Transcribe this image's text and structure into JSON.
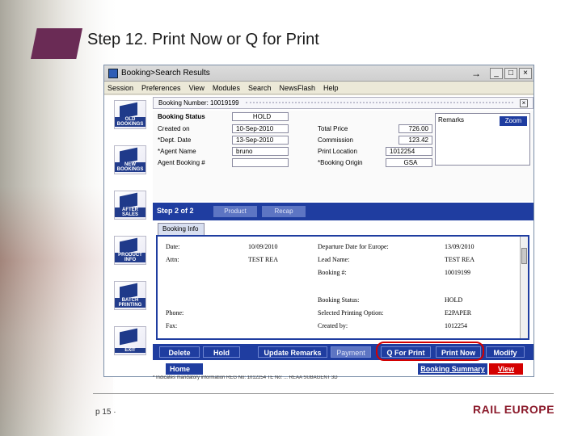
{
  "slide": {
    "title": "Step 12. Print Now or Q for Print",
    "page": "p 15 ·",
    "brand": "RAIL EUROPE",
    "accent": "#6a2b55"
  },
  "window": {
    "title": "Booking>Search Results",
    "menu": [
      "Session",
      "Preferences",
      "View",
      "Modules",
      "Search",
      "NewsFlash",
      "Help"
    ]
  },
  "sidebar": {
    "items": [
      "OLD BOOKINGS",
      "NEW BOOKINGS",
      "AFTER SALES",
      "PRODUCT INFO",
      "BATCH PRINTING",
      "EXIT"
    ]
  },
  "booking": {
    "number_label": "Booking Number: 10019199",
    "status_label": "Booking Status",
    "status_value": "HOLD",
    "created_label": "Created on",
    "created_value": "10-Sep-2010",
    "dept_label": "*Dept. Date",
    "dept_value": "13-Sep-2010",
    "agent_label": "*Agent Name",
    "agent_value": "bruno",
    "agent_booking_label": "Agent Booking #",
    "agent_booking_value": "",
    "total_label": "Total Price",
    "total_value": "726.00",
    "commission_label": "Commission",
    "commission_value": "123.42",
    "location_label": "Print Location",
    "location_value": "1012254",
    "origin_label": "*Booking Origin",
    "origin_value": "GSA",
    "remarks_label": "Remarks",
    "zoom_label": "Zoom"
  },
  "steps": {
    "label": "Step 2 of 2",
    "tabs": [
      "Product",
      "Recap"
    ]
  },
  "tab": "Booking Info",
  "details": {
    "date_label": "Date:",
    "date_value": "10/09/2010",
    "attn_label": "Attn:",
    "attn_value": "TEST REA",
    "phone_label": "Phone:",
    "fax_label": "Fax:",
    "departure_label": "Departure Date for Europe:",
    "departure_value": "13/09/2010",
    "lead_label": "Lead Name:",
    "lead_value": "TEST REA",
    "booking_label": "Booking #:",
    "booking_value": "10019199",
    "status_label": "Booking Status:",
    "status_value": "HOLD",
    "printing_label": "Selected Printing Option:",
    "printing_value": "E2PAPER",
    "created_by_label": "Created by:",
    "created_by_value": "1012254"
  },
  "actions": {
    "delete": "Delete",
    "hold": "Hold",
    "update_remarks": "Update Remarks",
    "payment": "Payment",
    "q_for_print": "Q For Print",
    "print_now": "Print Now",
    "modify": "Modify"
  },
  "nav": {
    "home": "Home",
    "booking_summary": "Booking Summary",
    "view": "View"
  },
  "statusbar": "* Indicates mandatory information     REG No: 1012254   TE No: ...   REAA SUBAGENT 3D"
}
